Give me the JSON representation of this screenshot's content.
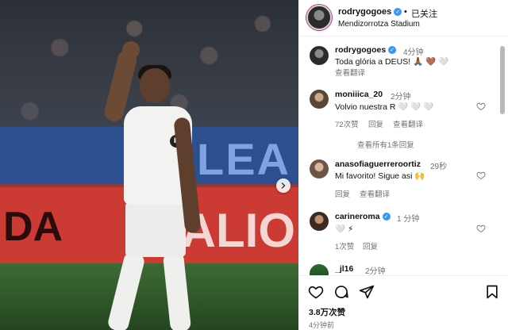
{
  "photo": {
    "board_blue_text": "LEA",
    "board_red_text_left": "DA",
    "board_red_text_right": "ALIO",
    "badge_text": "P"
  },
  "header": {
    "username": "rodrygogoes",
    "separator": "•",
    "follow_status": "已关注",
    "location": "Mendizorrotza Stadium"
  },
  "caption": {
    "username": "rodrygogoes",
    "time": "4分钟",
    "text": "Toda glória a DEUS! 🙏🏾 🤎 🤍",
    "see_translation": "查看翻译"
  },
  "comments": [
    {
      "username": "moniiica_20",
      "time": "2分钟",
      "text": "Volvio nuestra R 🤍 🤍 🤍",
      "likes": "72次赞",
      "reply": "回复",
      "see_translation": "查看翻译",
      "view_replies": "查看所有1条回复"
    },
    {
      "username": "anasofiaguerreroortiz",
      "time": "29秒",
      "text": "Mi favorito! Sigue asi 🙌",
      "reply": "回复",
      "see_translation": "查看翻译"
    },
    {
      "username": "carineroma",
      "time": "1 分钟",
      "text": "🤍 ⚡",
      "likes": "1次赞",
      "reply": "回复"
    },
    {
      "username": "_jl16",
      "time": "2分钟"
    }
  ],
  "footer": {
    "likes": "3.8万次赞",
    "posted_ago": "4分钟前"
  },
  "icons": {
    "like": "heart-icon",
    "comment": "comment-icon",
    "share": "send-icon",
    "save": "bookmark-icon",
    "next": "chevron-right-icon"
  },
  "colors": {
    "verified": "#3897f0",
    "secondary_text": "#737373"
  }
}
